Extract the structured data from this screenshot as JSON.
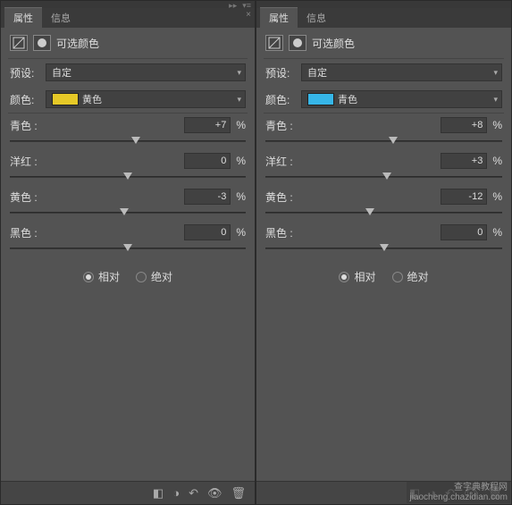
{
  "tabs": {
    "attr": "属性",
    "info": "信息"
  },
  "panelTitle": "可选颜色",
  "labels": {
    "preset": "预设:",
    "color": "颜色:",
    "pct": "%"
  },
  "radios": {
    "relative": "相对",
    "absolute": "绝对"
  },
  "left": {
    "preset": "自定",
    "colorName": "黄色",
    "swatch": "#e6c927",
    "sliders": [
      {
        "name": "青色 :",
        "val": "+7",
        "pos": 53.5
      },
      {
        "name": "洋红 :",
        "val": "0",
        "pos": 50
      },
      {
        "name": "黄色 :",
        "val": "-3",
        "pos": 48.5
      },
      {
        "name": "黑色 :",
        "val": "0",
        "pos": 50
      }
    ]
  },
  "right": {
    "preset": "自定",
    "colorName": "青色",
    "swatch": "#36b6e8",
    "sliders": [
      {
        "name": "青色 :",
        "val": "+8",
        "pos": 54
      },
      {
        "name": "洋红 :",
        "val": "+3",
        "pos": 51.5
      },
      {
        "name": "黄色 :",
        "val": "-12",
        "pos": 44
      },
      {
        "name": "黑色 :",
        "val": "0",
        "pos": 50
      }
    ]
  },
  "watermark": {
    "line1": "查字典教程网",
    "line2": "jiaocheng.chazidian.com"
  }
}
